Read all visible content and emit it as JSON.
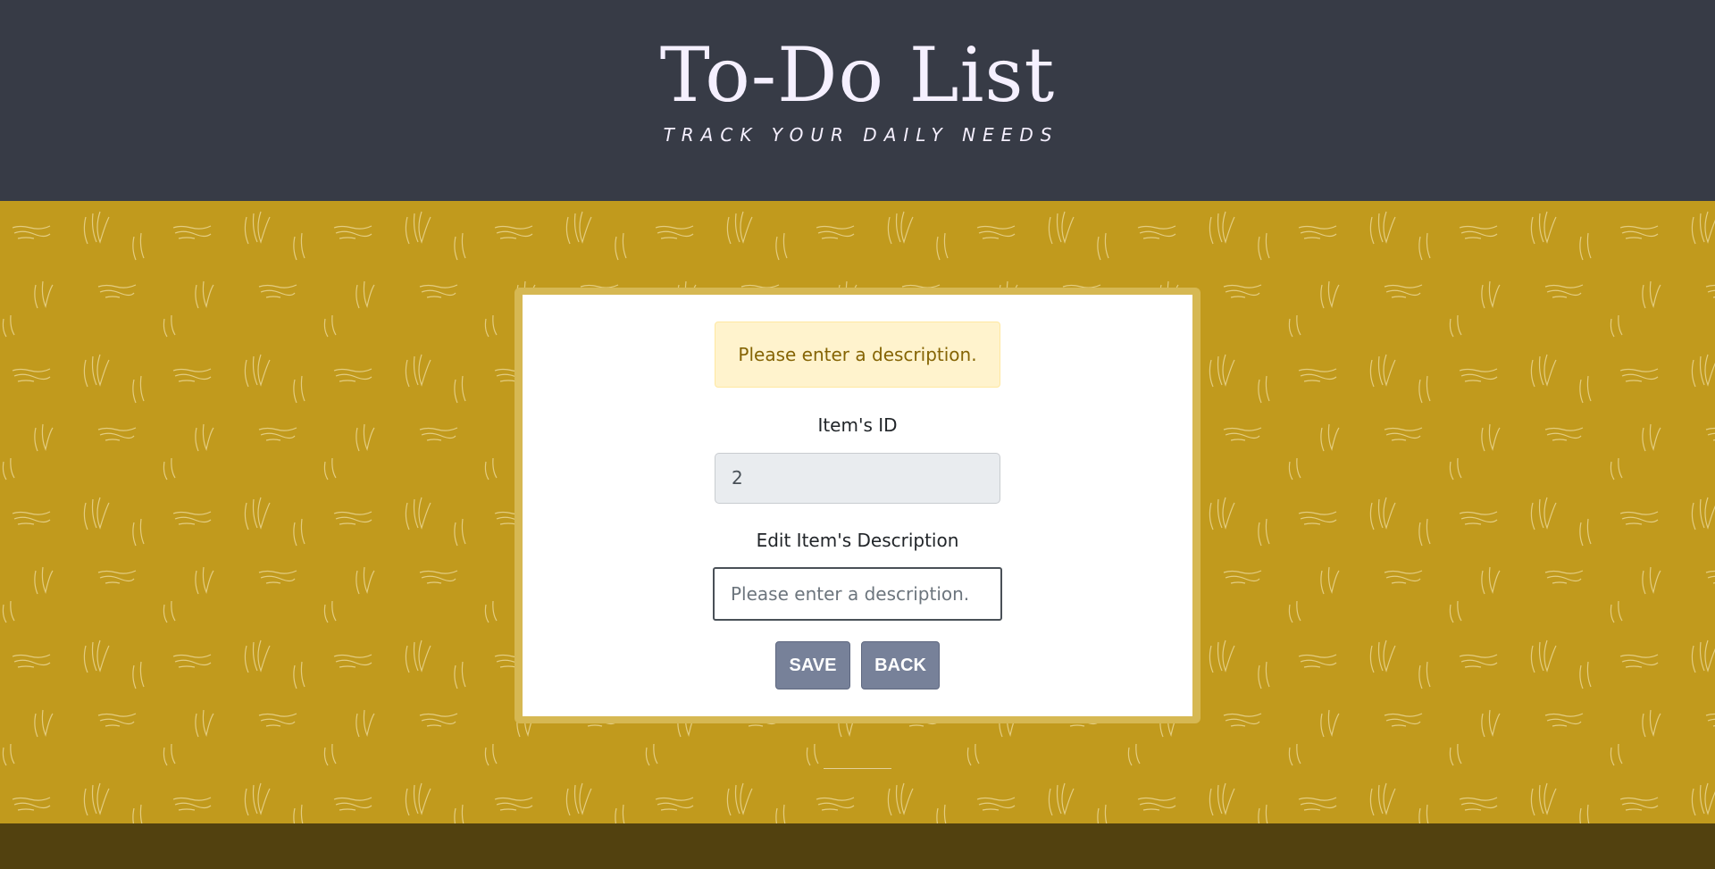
{
  "header": {
    "title": "To-Do List",
    "subtitle": "TRACK YOUR DAILY NEEDS"
  },
  "alert": {
    "message": "Please enter a description."
  },
  "form": {
    "id_label": "Item's ID",
    "id_value": "2",
    "description_label": "Edit Item's Description",
    "description_value": "",
    "description_placeholder": "Please enter a description.",
    "save_label": "SAVE",
    "back_label": "BACK"
  },
  "colors": {
    "header_bg": "#373b46",
    "page_bg": "#c19a1d",
    "button_bg": "#778199",
    "alert_bg": "#fff3cd",
    "alert_text": "#856404",
    "footer_bg": "#52410f"
  }
}
